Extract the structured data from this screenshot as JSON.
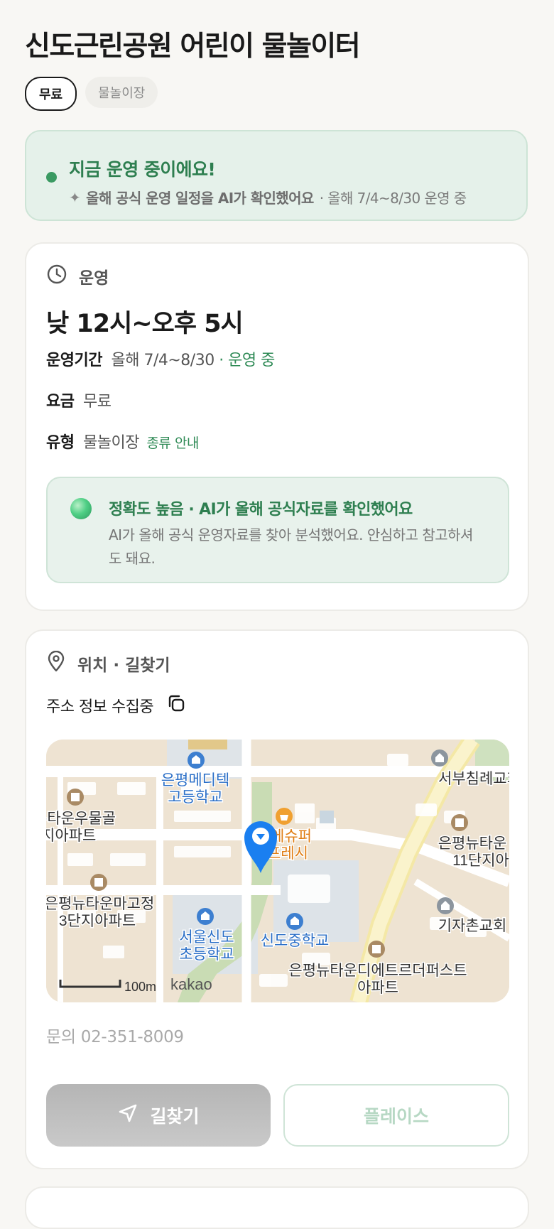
{
  "page": {
    "title": "신도근린공원 어린이 물놀이터",
    "tags": [
      "무료",
      "물놀이장"
    ]
  },
  "status": {
    "title": "지금 운영 중이에요!",
    "ai_note": "올해 공식 운영 일정을 AI가 확인했어요",
    "period_note": "· 올해 7/4~8/30 운영 중"
  },
  "operation": {
    "header": "운영",
    "hours": "낮 12시~오후 5시",
    "period_label": "운영기간",
    "period_value": "올해 7/4~8/30",
    "period_status": "· 운영 중",
    "fee_label": "요금",
    "fee_value": "무료",
    "type_label": "유형",
    "type_value": "물놀이장",
    "type_link": "종류 안내",
    "ai_title": "정확도 높음 · AI가 올해 공식자료를 확인했어요",
    "ai_body": "AI가 올해 공식 운영자료를 찾아 분석했어요. 안심하고 참고하셔도 돼요."
  },
  "location": {
    "header": "위치 · 길찾기",
    "address": "주소 정보 수집중",
    "map_labels": {
      "school_high": "은평메디텍",
      "school_high2": "고등학교",
      "apt1a": "뉴타운우물골",
      "apt1b": "단지아파트",
      "store1": "에슈퍼",
      "store2": "프레시",
      "apt2a": "은평뉴타운마고정",
      "apt2b": "3단지아파트",
      "elem1": "서울신도",
      "elem2": "초등학교",
      "middle": "신도중학교",
      "church1": "서부침례교회",
      "apt3a": "은평뉴타운",
      "apt3b": "11단지아",
      "church2": "기자촌교회",
      "apt4a": "은평뉴타운디에트르더퍼스트",
      "apt4b": "아파트",
      "scale": "100m",
      "brand": "kakao"
    },
    "contact": "문의 02-351-8009",
    "nav_button": "길찾기",
    "place_button": "플레이스"
  },
  "colors": {
    "accent_green": "#2e8a55",
    "status_bg": "#e5f1ea",
    "map_pin": "#1a7ff0"
  }
}
